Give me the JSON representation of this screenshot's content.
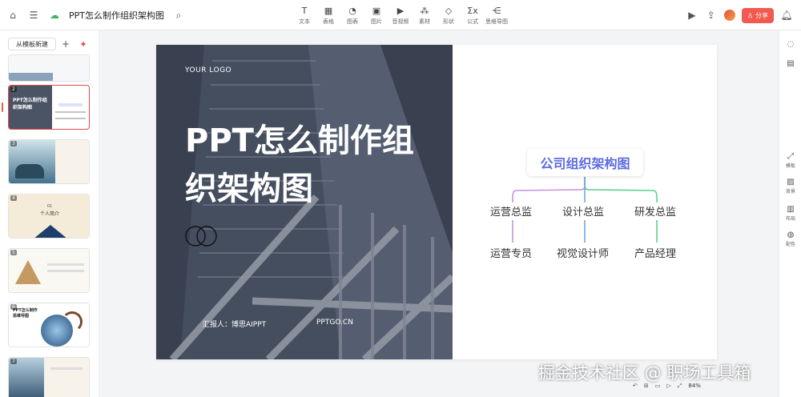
{
  "topbar": {
    "doc_title": "PPT怎么制作组织架构图",
    "tools": [
      {
        "icon": "text-icon",
        "glyph": "T",
        "label": "文本"
      },
      {
        "icon": "table-icon",
        "glyph": "▦",
        "label": "表格"
      },
      {
        "icon": "chart-icon",
        "glyph": "◔",
        "label": "图表"
      },
      {
        "icon": "image-icon",
        "glyph": "▣",
        "label": "图片"
      },
      {
        "icon": "video-icon",
        "glyph": "▶",
        "label": "音视频"
      },
      {
        "icon": "material-icon",
        "glyph": "⁂",
        "label": "素材"
      },
      {
        "icon": "shape-icon",
        "glyph": "◇",
        "label": "形状"
      },
      {
        "icon": "formula-icon",
        "glyph": "Σx",
        "label": "公式"
      },
      {
        "icon": "mindmap-icon",
        "glyph": "⋲",
        "label": "思维导图"
      }
    ],
    "share_label": "分享"
  },
  "sidepanel": {
    "new_from_template": "从模板新建",
    "thumbs": [
      {
        "num": "",
        "style": "light"
      },
      {
        "num": "2",
        "style": "active"
      },
      {
        "num": "3",
        "style": "sea"
      },
      {
        "num": "4",
        "style": "beige",
        "caption_top": "01",
        "caption": "个人简介"
      },
      {
        "num": "5",
        "style": "pyramid"
      },
      {
        "num": "6",
        "style": "mindmap",
        "caption": "PPT怎么制作思维导图"
      },
      {
        "num": "7",
        "style": "scene"
      }
    ]
  },
  "slide": {
    "logo": "YOUR LOGO",
    "title": "PPT怎么制作组织架构图",
    "presenter": "汇报人：博思AIPPT",
    "site": "PPTGO.CN",
    "org_root": "公司组织架构图",
    "level1": [
      "运营总监",
      "设计总监",
      "研发总监"
    ],
    "level2": [
      "运营专员",
      "视觉设计师",
      "产品经理"
    ],
    "colors": {
      "left": "#c792e0",
      "center": "#6fa8dc",
      "right": "#5fd08c",
      "root_text": "#5b6be0"
    }
  },
  "rightbar": {
    "items": [
      {
        "icon": "comment-icon",
        "glyph": "◌",
        "label": ""
      },
      {
        "icon": "notes-icon",
        "glyph": "▤",
        "label": ""
      },
      {
        "icon": "template-icon",
        "glyph": "⤢",
        "label": "模板"
      },
      {
        "icon": "background-icon",
        "glyph": "▨",
        "label": "背景"
      },
      {
        "icon": "layout-icon",
        "glyph": "▥",
        "label": "布局"
      },
      {
        "icon": "palette-icon",
        "glyph": "◍",
        "label": "配色"
      }
    ]
  },
  "bottom": {
    "zoom": "84%"
  },
  "watermark": "掘金技术社区 @ 职场工具箱"
}
